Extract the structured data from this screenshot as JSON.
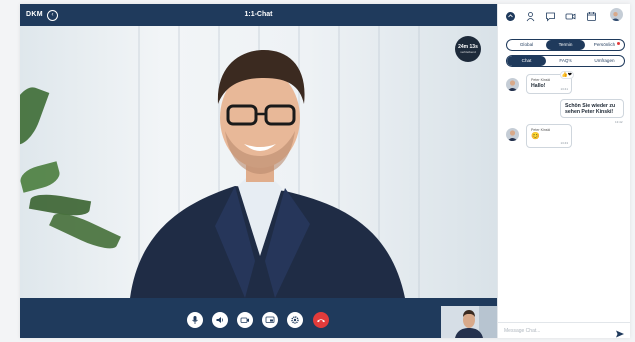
{
  "header": {
    "logo": "DKM",
    "logo_sub": "",
    "back_icon": "back-arrow-icon",
    "title": "1:1-Chat"
  },
  "timer": {
    "time": "24m 13s",
    "label": "verbleibend"
  },
  "controls": [
    {
      "name": "mic-button",
      "icon": "microphone-icon"
    },
    {
      "name": "speaker-button",
      "icon": "speaker-icon"
    },
    {
      "name": "camera-button",
      "icon": "camera-icon"
    },
    {
      "name": "screen-share-button",
      "icon": "screen-share-icon"
    },
    {
      "name": "settings-button",
      "icon": "gear-icon"
    },
    {
      "name": "hang-up-button",
      "icon": "phone-hangup-icon"
    }
  ],
  "colors": {
    "primary": "#1f3a5c",
    "hangup": "#e23b3b"
  },
  "chat": {
    "icons": [
      "home-icon",
      "person-icon",
      "chat-icon",
      "video-icon",
      "calendar-icon",
      "avatar"
    ],
    "tabs_top": [
      {
        "label": "Global",
        "active": false
      },
      {
        "label": "Termin",
        "active": true
      },
      {
        "label": "Persönlich",
        "active": false,
        "badge": true
      }
    ],
    "tabs_bottom": [
      {
        "label": "Chat",
        "active": true
      },
      {
        "label": "FAQ's",
        "active": false
      },
      {
        "label": "Umfragen",
        "active": false
      }
    ],
    "messages": [
      {
        "from": "Peter Kinski",
        "text": "Hallo!",
        "time": "13:41",
        "side": "left",
        "reaction": "👍❤"
      },
      {
        "from": "",
        "text": "Schön Sie wieder zu sehen Peter Kinski!",
        "time": "13:42",
        "side": "right"
      },
      {
        "from": "Peter Kinski",
        "text": "😊",
        "time": "13:43",
        "side": "left"
      }
    ],
    "input_placeholder": "Message Chat...",
    "send_icon": "send-icon"
  }
}
